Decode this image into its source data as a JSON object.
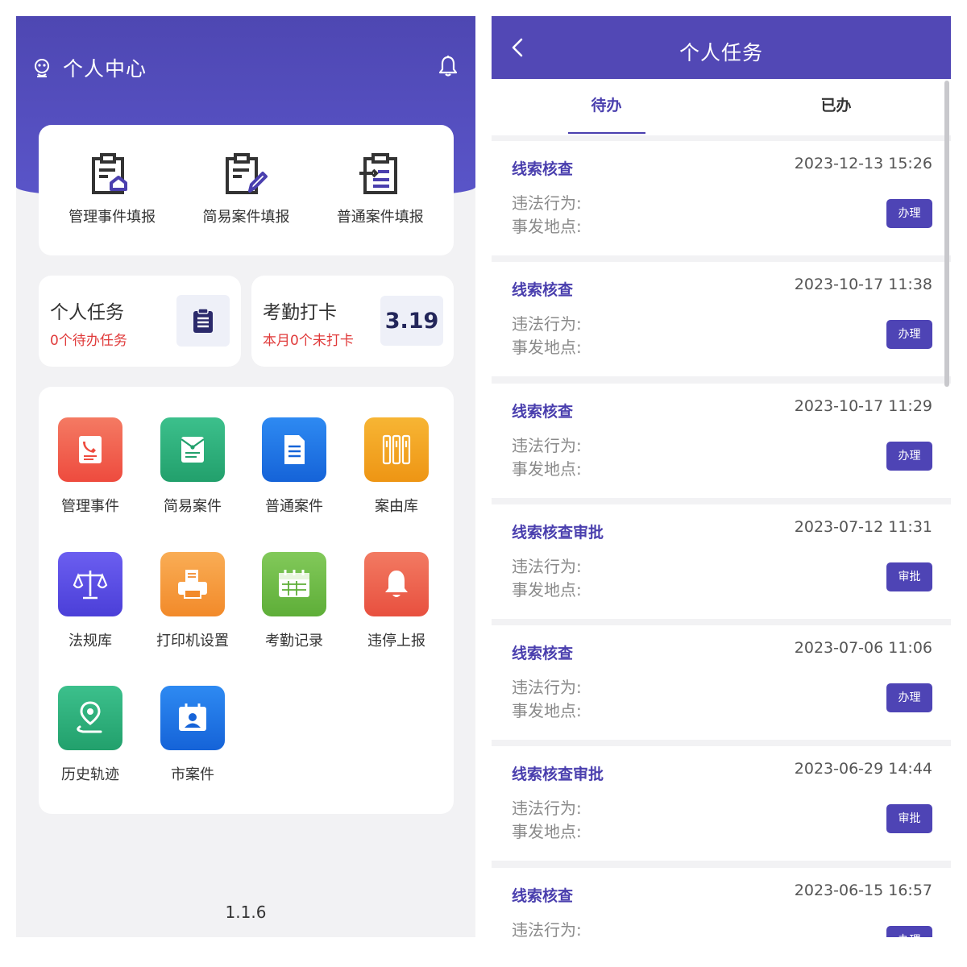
{
  "left": {
    "header": {
      "title": "个人中心"
    },
    "report_card": {
      "items": [
        {
          "label": "管理事件填报",
          "icon": "clipboard-home-icon"
        },
        {
          "label": "简易案件填报",
          "icon": "clipboard-pen-icon"
        },
        {
          "label": "普通案件填报",
          "icon": "clipboard-list-icon"
        }
      ]
    },
    "stats": {
      "task": {
        "title": "个人任务",
        "sub": "0个待办任务",
        "icon": "clipboard-icon"
      },
      "attendance": {
        "title": "考勤打卡",
        "sub": "本月0个未打卡",
        "value": "3.19"
      }
    },
    "apps": [
      {
        "label": "管理事件",
        "icon": "phone-document-icon",
        "color": "#f0574a"
      },
      {
        "label": "简易案件",
        "icon": "envelope-document-icon",
        "color": "#2fae7c"
      },
      {
        "label": "普通案件",
        "icon": "document-icon",
        "color": "#1e72e6"
      },
      {
        "label": "案由库",
        "icon": "books-icon",
        "color": "#f0a41a"
      },
      {
        "label": "法规库",
        "icon": "scales-icon",
        "color": "#5a4de0"
      },
      {
        "label": "打印机设置",
        "icon": "printer-icon",
        "color": "#f49a3a"
      },
      {
        "label": "考勤记录",
        "icon": "calendar-icon",
        "color": "#6dbd45"
      },
      {
        "label": "违停上报",
        "icon": "bell-icon",
        "color": "#ee5a47"
      },
      {
        "label": "历史轨迹",
        "icon": "location-pin-icon",
        "color": "#2fae7c"
      },
      {
        "label": "市案件",
        "icon": "person-badge-icon",
        "color": "#1e72e6"
      }
    ],
    "version": "1.1.6"
  },
  "right": {
    "header": {
      "title": "个人任务"
    },
    "tabs": [
      {
        "label": "待办",
        "active": true
      },
      {
        "label": "已办",
        "active": false
      }
    ],
    "field_labels": {
      "violation": "违法行为:",
      "location": "事发地点:"
    },
    "tasks": [
      {
        "title": "线索核查",
        "time": "2023-12-13 15:26",
        "action": "办理"
      },
      {
        "title": "线索核查",
        "time": "2023-10-17 11:38",
        "action": "办理"
      },
      {
        "title": "线索核查",
        "time": "2023-10-17 11:29",
        "action": "办理"
      },
      {
        "title": "线索核查审批",
        "time": "2023-07-12 11:31",
        "action": "审批"
      },
      {
        "title": "线索核查",
        "time": "2023-07-06 11:06",
        "action": "办理"
      },
      {
        "title": "线索核查审批",
        "time": "2023-06-29 14:44",
        "action": "审批"
      },
      {
        "title": "线索核查",
        "time": "2023-06-15 16:57",
        "action": "办理"
      }
    ]
  }
}
